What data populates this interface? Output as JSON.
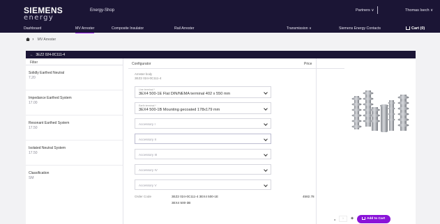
{
  "header": {
    "brand_top": "SIEMENS",
    "brand_bottom": "energy",
    "shop_name": "Energy-Shop",
    "nav": [
      "Dashboard",
      "MV Arrester",
      "Composite Insulator",
      "Rail Arrester"
    ],
    "transmission": "Transmission ∨",
    "partners": "Partners ∨",
    "user": "Thomas Isech ∨",
    "contacts": "Siemens Energy Contacts",
    "cart": "Cart (0)"
  },
  "breadcrumb": {
    "current": "MV Arrester"
  },
  "product_bar": {
    "back": "←",
    "title": "3EZ2 024-0C111-4"
  },
  "filter": {
    "heading": "Filter",
    "items": [
      {
        "label": "Solidly Earthed Neutral",
        "value": "7.20"
      },
      {
        "label": "Impedance Earthed System",
        "value": "17.00"
      },
      {
        "label": "Resonant Earthed System",
        "value": "17.50"
      },
      {
        "label": "Isolated Neutral System",
        "value": "17.50"
      },
      {
        "label": "Classification",
        "value": "SM"
      }
    ]
  },
  "configurator": {
    "heading": "Configurator",
    "price_heading": "Price",
    "arrester_label": "Arrester body",
    "arrester_value": "3EZ2 024-0C111-4",
    "dropdowns": [
      {
        "small": "Line terminal *",
        "main": "3EX4 500-1E Flat DIN/NEMA terminal 402 x 550 mm",
        "placeholder": ""
      },
      {
        "small": "Earth terminal *",
        "main": "3EX4 500-1B Mounting gecoated 178x179 mm",
        "placeholder": ""
      },
      {
        "small": "",
        "main": "",
        "placeholder": "Accessory I"
      },
      {
        "small": "",
        "main": "",
        "placeholder": "Accessory II"
      },
      {
        "small": "",
        "main": "",
        "placeholder": "Accessory III"
      },
      {
        "small": "",
        "main": "",
        "placeholder": "Accessory IV"
      },
      {
        "small": "",
        "main": "",
        "placeholder": "Accessory V"
      }
    ],
    "order_code_label": "Order Code",
    "order_code_line1": "3EZ2 024-0C111-4 3EX4 500-1E",
    "order_code_line2": "3EX4 500-3B",
    "price": "4582.78"
  },
  "actions": {
    "minus": "-",
    "quantity": "1",
    "plus": "+",
    "add_to_cart": "Add to Cart"
  }
}
